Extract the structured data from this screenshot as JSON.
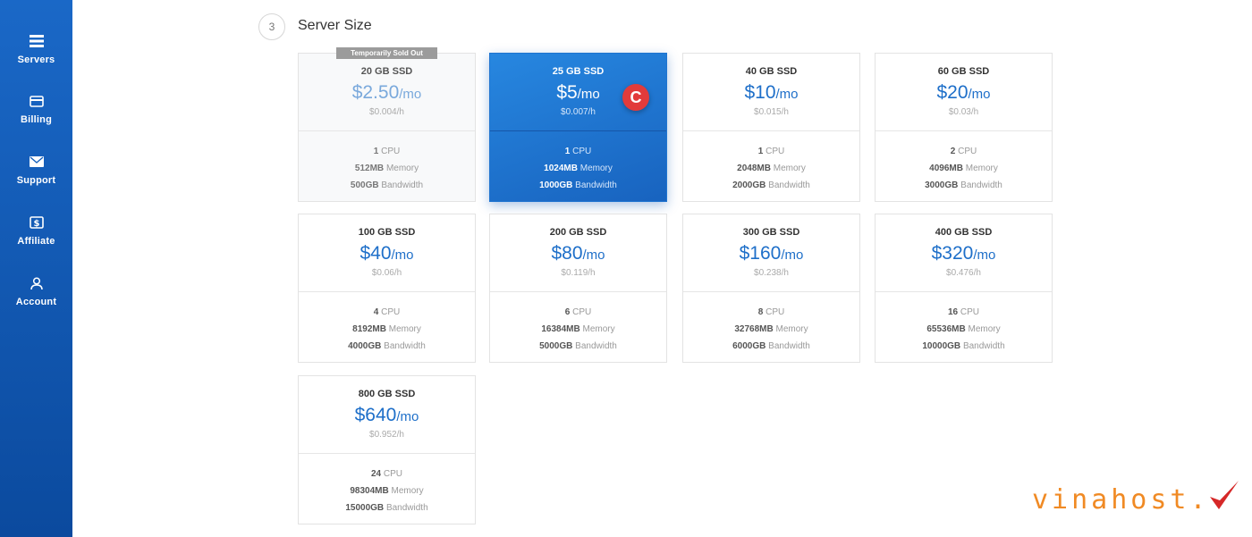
{
  "sidebar": {
    "items": [
      {
        "label": "Servers",
        "icon": "servers-icon"
      },
      {
        "label": "Billing",
        "icon": "card-icon"
      },
      {
        "label": "Support",
        "icon": "mail-icon"
      },
      {
        "label": "Affiliate",
        "icon": "dollar-icon"
      },
      {
        "label": "Account",
        "icon": "user-icon"
      }
    ]
  },
  "section": {
    "step": "3",
    "title": "Server Size"
  },
  "plans": [
    {
      "storage": "20 GB SSD",
      "price": "$2.50",
      "unit": "/mo",
      "hourly": "$0.004/h",
      "cpu": "1",
      "cpu_label": "CPU",
      "memory": "512MB",
      "memory_label": "Memory",
      "bandwidth": "500GB",
      "bandwidth_label": "Bandwidth",
      "badge": "Temporarily Sold Out"
    },
    {
      "storage": "25 GB SSD",
      "price": "$5",
      "unit": "/mo",
      "hourly": "$0.007/h",
      "cpu": "1",
      "cpu_label": "CPU",
      "memory": "1024MB",
      "memory_label": "Memory",
      "bandwidth": "1000GB",
      "bandwidth_label": "Bandwidth",
      "marker": "C"
    },
    {
      "storage": "40 GB SSD",
      "price": "$10",
      "unit": "/mo",
      "hourly": "$0.015/h",
      "cpu": "1",
      "cpu_label": "CPU",
      "memory": "2048MB",
      "memory_label": "Memory",
      "bandwidth": "2000GB",
      "bandwidth_label": "Bandwidth"
    },
    {
      "storage": "60 GB SSD",
      "price": "$20",
      "unit": "/mo",
      "hourly": "$0.03/h",
      "cpu": "2",
      "cpu_label": "CPU",
      "memory": "4096MB",
      "memory_label": "Memory",
      "bandwidth": "3000GB",
      "bandwidth_label": "Bandwidth"
    },
    {
      "storage": "100 GB SSD",
      "price": "$40",
      "unit": "/mo",
      "hourly": "$0.06/h",
      "cpu": "4",
      "cpu_label": "CPU",
      "memory": "8192MB",
      "memory_label": "Memory",
      "bandwidth": "4000GB",
      "bandwidth_label": "Bandwidth"
    },
    {
      "storage": "200 GB SSD",
      "price": "$80",
      "unit": "/mo",
      "hourly": "$0.119/h",
      "cpu": "6",
      "cpu_label": "CPU",
      "memory": "16384MB",
      "memory_label": "Memory",
      "bandwidth": "5000GB",
      "bandwidth_label": "Bandwidth"
    },
    {
      "storage": "300 GB SSD",
      "price": "$160",
      "unit": "/mo",
      "hourly": "$0.238/h",
      "cpu": "8",
      "cpu_label": "CPU",
      "memory": "32768MB",
      "memory_label": "Memory",
      "bandwidth": "6000GB",
      "bandwidth_label": "Bandwidth"
    },
    {
      "storage": "400 GB SSD",
      "price": "$320",
      "unit": "/mo",
      "hourly": "$0.476/h",
      "cpu": "16",
      "cpu_label": "CPU",
      "memory": "65536MB",
      "memory_label": "Memory",
      "bandwidth": "10000GB",
      "bandwidth_label": "Bandwidth"
    },
    {
      "storage": "800 GB SSD",
      "price": "$640",
      "unit": "/mo",
      "hourly": "$0.952/h",
      "cpu": "24",
      "cpu_label": "CPU",
      "memory": "98304MB",
      "memory_label": "Memory",
      "bandwidth": "15000GB",
      "bandwidth_label": "Bandwidth"
    }
  ],
  "watermark": {
    "text": "vinahost."
  },
  "colors": {
    "sidebar": "#1a68c7",
    "accent": "#1e6fc9",
    "selected": "#2787e0",
    "marker": "#e23b3b",
    "watermark": "#f08a24",
    "watermark_check": "#d62828"
  }
}
